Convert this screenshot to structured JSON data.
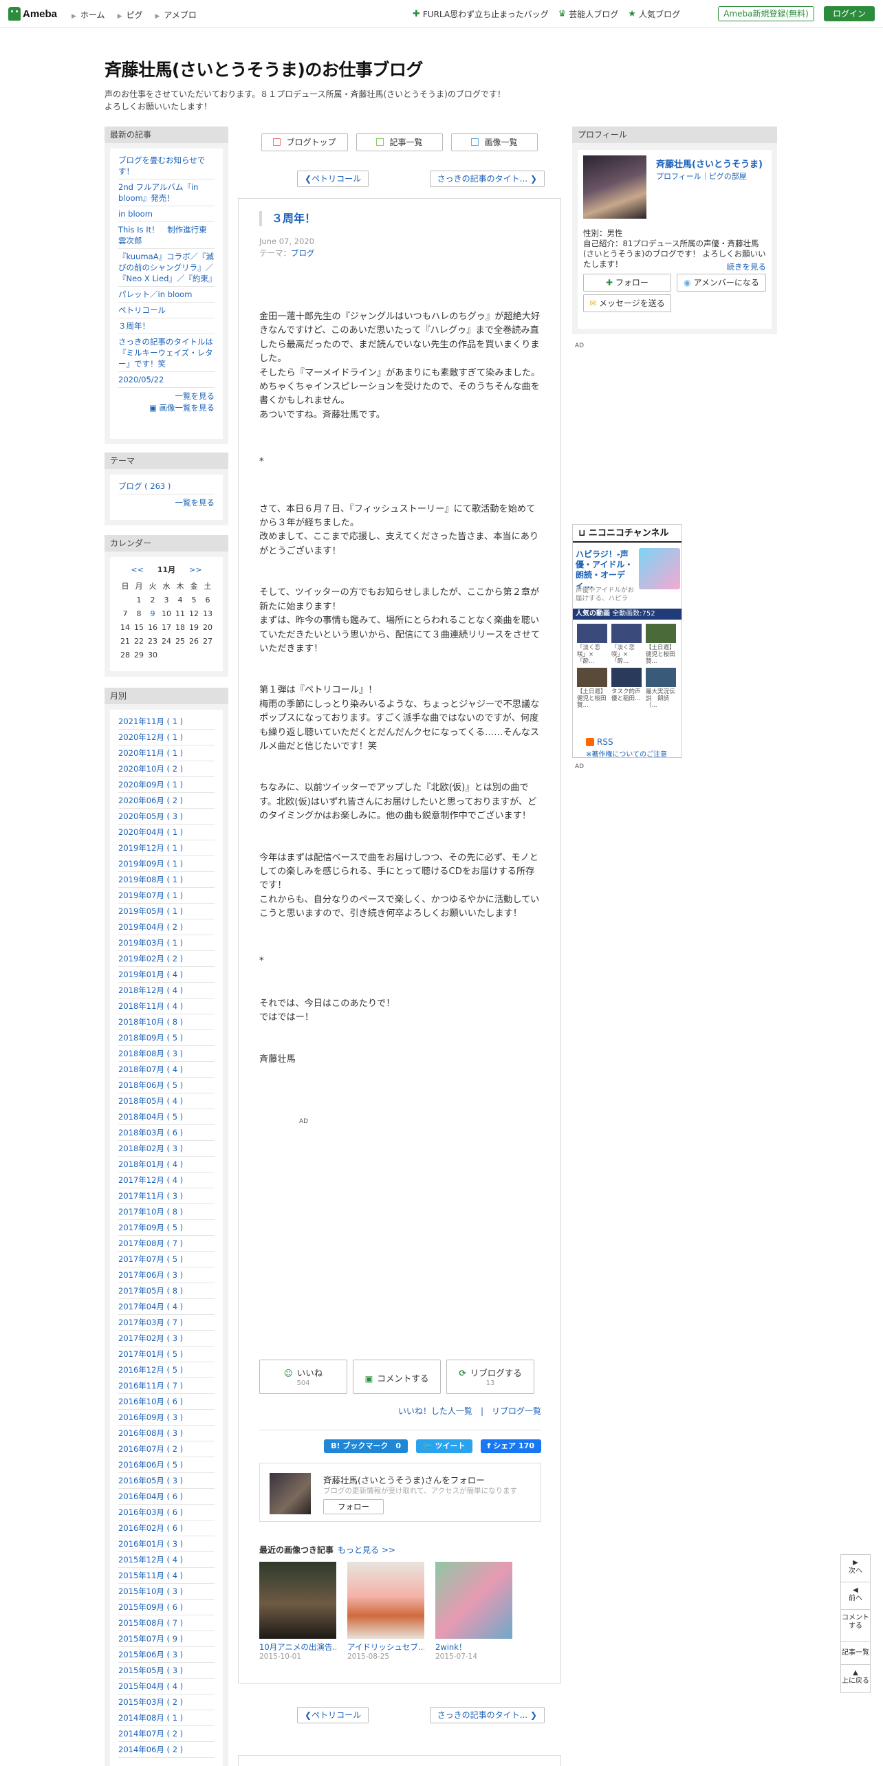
{
  "header": {
    "logo": "Ameba",
    "nav": [
      "ホーム",
      "ピグ",
      "アメブロ"
    ],
    "links": [
      {
        "icon": "leaf-icon",
        "label": "FURLA思わず立ち止まったバッグ"
      },
      {
        "icon": "crown-icon",
        "label": "芸能人ブログ"
      },
      {
        "icon": "star-icon",
        "label": "人気ブログ"
      }
    ],
    "register": "Ameba新規登録(無料)",
    "login": "ログイン"
  },
  "blog": {
    "title": "斉藤壮馬(さいとうそうま)のお仕事ブログ",
    "desc1": "声のお仕事をさせていただいております。８１プロデュース所属・斉藤壮馬(さいとうそうま)のブログです！",
    "desc2": "よろしくお願いいたします！"
  },
  "topbuttons": [
    "ブログトップ",
    "記事一覧",
    "画像一覧"
  ],
  "pager": {
    "prev": "ペトリコール",
    "next": "さっきの記事のタイト..."
  },
  "entry": {
    "title": "３周年！",
    "date": "June 07, 2020",
    "theme_label": "テーマ：",
    "theme": "ブログ",
    "paragraphs": [
      "金田一蓮十郎先生の『ジャングルはいつもハレのちグゥ』が超絶大好きなんですけど、このあいだ思いたって『ハレグゥ』まで全巻読み直したら最高だったので、まだ読んでいない先生の作品を買いまくりました。\nそしたら『マーメイドライン』があまりにも素敵すぎて染みました。めちゃくちゃインスピレーションを受けたので、そのうちそんな曲を書くかもしれません。\nあついですね。斉藤壮馬です。",
      "*",
      "さて、本日６月７日、『フィッシュストーリー』にて歌活動を始めてから３年が経ちました。\n改めまして、ここまで応援し、支えてくださった皆さま、本当にありがとうございます！",
      "そして、ツイッターの方でもお知らせしましたが、ここから第２章が新たに始まります！\nまずは、昨今の事情も鑑みて、場所にとらわれることなく楽曲を聴いていただきたいという思いから、配信にて３曲連続リリースをさせていただきます！",
      "第１弾は『ペトリコール』！\n梅雨の季節にしっとり染みいるような、ちょっとジャジーで不思議なポップスになっております。すごく派手な曲ではないのですが、何度も繰り返し聴いていただくとだんだんクセになってくる……そんなスルメ曲だと信じたいです！笑",
      "ちなみに、以前ツイッターでアップした『北欧(仮)』とは別の曲です。北欧(仮)はいずれ皆さんにお届けしたいと思っておりますが、どのタイミングかはお楽しみに。他の曲も鋭意制作中でございます！",
      "今年はまずは配信ベースで曲をお届けしつつ、その先に必ず、モノとしての楽しみを感じられる、手にとって聴けるCDをお届けする所存です！\nこれからも、自分なりのペースで楽しく、かつゆるやかに活動していこうと思いますので、引き続き何卒よろしくお願いいたします！",
      "*",
      "それでは、今日はこのあたりで！\nではではー！",
      "斉藤壮馬"
    ],
    "ad": "AD",
    "like": "いいね",
    "like_count": "504",
    "comment": "コメントする",
    "reblog": "リブログする",
    "reblog_count": "13",
    "liked_users": "いいね！した人一覧",
    "reblog_list": "リブログ一覧",
    "sep": "|",
    "hatena": "B! ブックマーク",
    "hatena_count": "0",
    "tweet": "ツイート",
    "fb": "シェア",
    "fb_count": "170",
    "follow_title": "斉藤壮馬(さいとうそうま)さんをフォロー",
    "follow_desc": "ブログの更新情報が受け取れて、アクセスが簡単になります",
    "follow_btn": "フォロー",
    "recent_title": "最近の画像つき記事",
    "recent_more": "もっと見る >>",
    "recent": [
      {
        "caption": "10月アニメの出演告...",
        "date": "2015-10-01"
      },
      {
        "caption": "アイドリッシュセブ...",
        "date": "2015-08-25"
      },
      {
        "caption": "2wink！",
        "date": "2015-07-14"
      }
    ]
  },
  "sidebar": {
    "latest_h": "最新の記事",
    "latest": [
      "ブログを畳むお知らせです！",
      "2nd フルアルバム『in bloom』発売！",
      "in bloom",
      "This Is It！　制作進行東雲次郎",
      "『kuumaA』コラボ／『滅びの前のシャングリラ』／『Neo X Lied』／『約束』",
      "パレット／in bloom",
      "ペトリコール",
      "３周年！",
      "さっきの記事のタイトルは『ミルキーウェイズ・レター』です！笑",
      "2020/05/22"
    ],
    "latest_more": "一覧を見る",
    "latest_img_more": "画像一覧を見る",
    "theme_h": "テーマ",
    "theme_item": "ブログ ( 263 )",
    "theme_more": "一覧を見る",
    "cal_h": "カレンダー",
    "cal_prev": "<<",
    "cal_month": "11月",
    "cal_next": ">>",
    "cal_days": [
      "日",
      "月",
      "火",
      "水",
      "木",
      "金",
      "土"
    ],
    "cal_rows": [
      [
        "",
        "1",
        "2",
        "3",
        "4",
        "5",
        "6"
      ],
      [
        "7",
        "8",
        "9",
        "10",
        "11",
        "12",
        "13"
      ],
      [
        "14",
        "15",
        "16",
        "17",
        "18",
        "19",
        "20"
      ],
      [
        "21",
        "22",
        "23",
        "24",
        "25",
        "26",
        "27"
      ],
      [
        "28",
        "29",
        "30",
        "",
        "",
        "",
        ""
      ]
    ],
    "month_h": "月別",
    "months": [
      "2021年11月 ( 1 )",
      "2020年12月 ( 1 )",
      "2020年11月 ( 1 )",
      "2020年10月 ( 2 )",
      "2020年09月 ( 1 )",
      "2020年06月 ( 2 )",
      "2020年05月 ( 3 )",
      "2020年04月 ( 1 )",
      "2019年12月 ( 1 )",
      "2019年09月 ( 1 )",
      "2019年08月 ( 1 )",
      "2019年07月 ( 1 )",
      "2019年05月 ( 1 )",
      "2019年04月 ( 2 )",
      "2019年03月 ( 1 )",
      "2019年02月 ( 2 )",
      "2019年01月 ( 4 )",
      "2018年12月 ( 4 )",
      "2018年11月 ( 4 )",
      "2018年10月 ( 8 )",
      "2018年09月 ( 5 )",
      "2018年08月 ( 3 )",
      "2018年07月 ( 4 )",
      "2018年06月 ( 5 )",
      "2018年05月 ( 4 )",
      "2018年04月 ( 5 )",
      "2018年03月 ( 6 )",
      "2018年02月 ( 3 )",
      "2018年01月 ( 4 )",
      "2017年12月 ( 4 )",
      "2017年11月 ( 3 )",
      "2017年10月 ( 8 )",
      "2017年09月 ( 5 )",
      "2017年08月 ( 7 )",
      "2017年07月 ( 5 )",
      "2017年06月 ( 3 )",
      "2017年05月 ( 8 )",
      "2017年04月 ( 4 )",
      "2017年03月 ( 7 )",
      "2017年02月 ( 3 )",
      "2017年01月 ( 5 )",
      "2016年12月 ( 5 )",
      "2016年11月 ( 7 )",
      "2016年10月 ( 6 )",
      "2016年09月 ( 3 )",
      "2016年08月 ( 3 )",
      "2016年07月 ( 2 )",
      "2016年06月 ( 5 )",
      "2016年05月 ( 3 )",
      "2016年04月 ( 6 )",
      "2016年03月 ( 6 )",
      "2016年02月 ( 6 )",
      "2016年01月 ( 3 )",
      "2015年12月 ( 4 )",
      "2015年11月 ( 4 )",
      "2015年10月 ( 3 )",
      "2015年09月 ( 6 )",
      "2015年08月 ( 7 )",
      "2015年07月 ( 9 )",
      "2015年06月 ( 3 )",
      "2015年05月 ( 3 )",
      "2015年04月 ( 4 )",
      "2015年03月 ( 2 )",
      "2014年08月 ( 1 )",
      "2014年07月 ( 2 )",
      "2014年06月 ( 2 )"
    ]
  },
  "profile": {
    "h": "プロフィール",
    "name": "斉藤壮馬(さいとうそうま)",
    "sub": "プロフィール｜ピグの部屋",
    "gender": "性別：男性",
    "intro": "自己紹介：81プロデュース所属の声優・斉藤壮馬(さいとうそうま)のブログです！ よろしくお願いいたします！",
    "cont": "続きを見る",
    "follow": "フォロー",
    "amember": "アメンバーになる",
    "message": "メッセージを送る",
    "ad": "AD"
  },
  "nico": {
    "logo": "ニコニコチャンネル",
    "title": "ハピラジ！-声優・アイドル・朗読・オーディ...",
    "desc": "声優やアイドルがお届けする、ハピラ",
    "bar": "人気の動画",
    "bar_count": "全動画数:752",
    "videos": [
      "「淡く恋咲」×「酔...",
      "「淡く恋咲」×「酔...",
      "【土日週】健児と桜田賢...",
      "【土日週】健児と桜田賢...",
      "タスク的声優と稲田...",
      "最大実況伝説　朗読（..."
    ],
    "rss": "RSS",
    "copyright": "※著作権についてのご注意",
    "ad": "AD"
  },
  "floatnav": [
    "次へ",
    "前へ",
    "コメントする",
    "記事一覧",
    "上に戻る"
  ]
}
